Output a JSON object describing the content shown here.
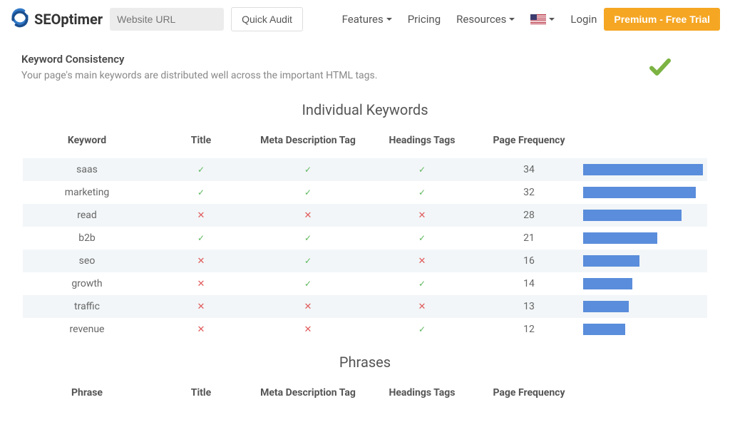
{
  "header": {
    "brand": "SEOptimer",
    "url_placeholder": "Website URL",
    "quick_audit_label": "Quick Audit",
    "nav": {
      "features": "Features",
      "pricing": "Pricing",
      "resources": "Resources",
      "login": "Login"
    },
    "premium_label": "Premium - Free Trial"
  },
  "section": {
    "title": "Keyword Consistency",
    "description": "Your page's main keywords are distributed well across the important HTML tags."
  },
  "keywords_table": {
    "title": "Individual Keywords",
    "columns": {
      "keyword": "Keyword",
      "title_col": "Title",
      "meta": "Meta Description Tag",
      "headings": "Headings Tags",
      "freq": "Page Frequency"
    }
  },
  "phrases_table": {
    "title": "Phrases",
    "columns": {
      "phrase": "Phrase",
      "title_col": "Title",
      "meta": "Meta Description Tag",
      "headings": "Headings Tags",
      "freq": "Page Frequency"
    }
  },
  "chart_data": {
    "type": "table",
    "title": "Individual Keywords",
    "max_frequency": 34,
    "columns": [
      "Keyword",
      "Title",
      "Meta Description Tag",
      "Headings Tags",
      "Page Frequency"
    ],
    "rows": [
      {
        "keyword": "saas",
        "title": true,
        "meta": true,
        "headings": true,
        "freq": 34
      },
      {
        "keyword": "marketing",
        "title": true,
        "meta": true,
        "headings": true,
        "freq": 32
      },
      {
        "keyword": "read",
        "title": false,
        "meta": false,
        "headings": false,
        "freq": 28
      },
      {
        "keyword": "b2b",
        "title": true,
        "meta": true,
        "headings": true,
        "freq": 21
      },
      {
        "keyword": "seo",
        "title": false,
        "meta": true,
        "headings": false,
        "freq": 16
      },
      {
        "keyword": "growth",
        "title": false,
        "meta": true,
        "headings": true,
        "freq": 14
      },
      {
        "keyword": "traffic",
        "title": false,
        "meta": false,
        "headings": false,
        "freq": 13
      },
      {
        "keyword": "revenue",
        "title": false,
        "meta": false,
        "headings": true,
        "freq": 12
      }
    ]
  },
  "marks": {
    "yes": "✓",
    "no": "✕"
  }
}
